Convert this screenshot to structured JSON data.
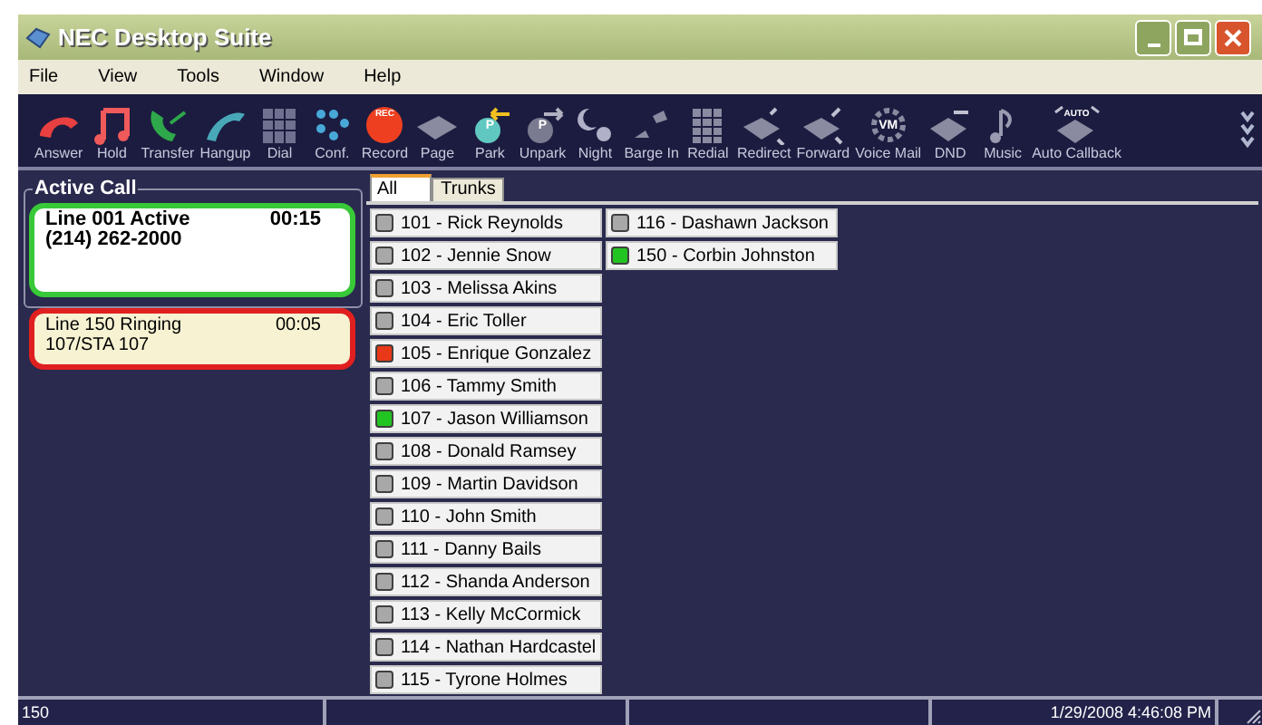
{
  "window": {
    "title": "NEC Desktop Suite"
  },
  "menu": [
    "File",
    "View",
    "Tools",
    "Window",
    "Help"
  ],
  "toolbar": [
    {
      "label": "Answer"
    },
    {
      "label": "Hold"
    },
    {
      "label": "Transfer"
    },
    {
      "label": "Hangup"
    },
    {
      "label": "Dial"
    },
    {
      "label": "Conf."
    },
    {
      "label": "Record",
      "badge": "REC"
    },
    {
      "label": "Page"
    },
    {
      "label": "Park",
      "badge": "P"
    },
    {
      "label": "Unpark",
      "badge": "P"
    },
    {
      "label": "Night"
    },
    {
      "label": "Barge In"
    },
    {
      "label": "Redial"
    },
    {
      "label": "Redirect"
    },
    {
      "label": "Forward"
    },
    {
      "label": "Voice Mail",
      "badge": "VM"
    },
    {
      "label": "DND"
    },
    {
      "label": "Music"
    },
    {
      "label": "Auto Callback",
      "badge": "AUTO"
    }
  ],
  "active_call": {
    "title": "Active Call",
    "calls": [
      {
        "kind": "active",
        "line": "Line 001 Active",
        "time": "00:15",
        "detail": "(214) 262-2000"
      },
      {
        "kind": "ringing",
        "line": "Line 150 Ringing",
        "time": "00:05",
        "detail": "107/STA 107"
      }
    ]
  },
  "tabs": [
    {
      "label": "All",
      "selected": true
    },
    {
      "label": "Trunks",
      "selected": false
    }
  ],
  "contacts": [
    [
      {
        "label": "101 - Rick Reynolds",
        "color": "#a8a8a8"
      },
      {
        "label": "102 - Jennie Snow",
        "color": "#a8a8a8"
      },
      {
        "label": "103 - Melissa Akins",
        "color": "#a8a8a8"
      },
      {
        "label": "104 - Eric Toller",
        "color": "#a8a8a8"
      },
      {
        "label": "105 - Enrique Gonzalez",
        "color": "#e83818"
      },
      {
        "label": "106 - Tammy Smith",
        "color": "#a8a8a8"
      },
      {
        "label": "107 - Jason Williamson",
        "color": "#22c422"
      },
      {
        "label": "108 - Donald Ramsey",
        "color": "#a8a8a8"
      },
      {
        "label": "109 - Martin Davidson",
        "color": "#a8a8a8"
      },
      {
        "label": "110 - John Smith",
        "color": "#a8a8a8"
      },
      {
        "label": "111 - Danny Bails",
        "color": "#a8a8a8"
      },
      {
        "label": "112 - Shanda Anderson",
        "color": "#a8a8a8"
      },
      {
        "label": "113 - Kelly McCormick",
        "color": "#a8a8a8"
      },
      {
        "label": "114 - Nathan Hardcastel",
        "color": "#a8a8a8"
      },
      {
        "label": "115 - Tyrone Holmes",
        "color": "#a8a8a8"
      }
    ],
    [
      {
        "label": "116 - Dashawn Jackson",
        "color": "#a8a8a8"
      },
      {
        "label": "150 - Corbin Johnston",
        "color": "#22c422"
      }
    ]
  ],
  "status_bar": {
    "extension": "150",
    "datetime": "1/29/2008 4:46:08 PM"
  }
}
